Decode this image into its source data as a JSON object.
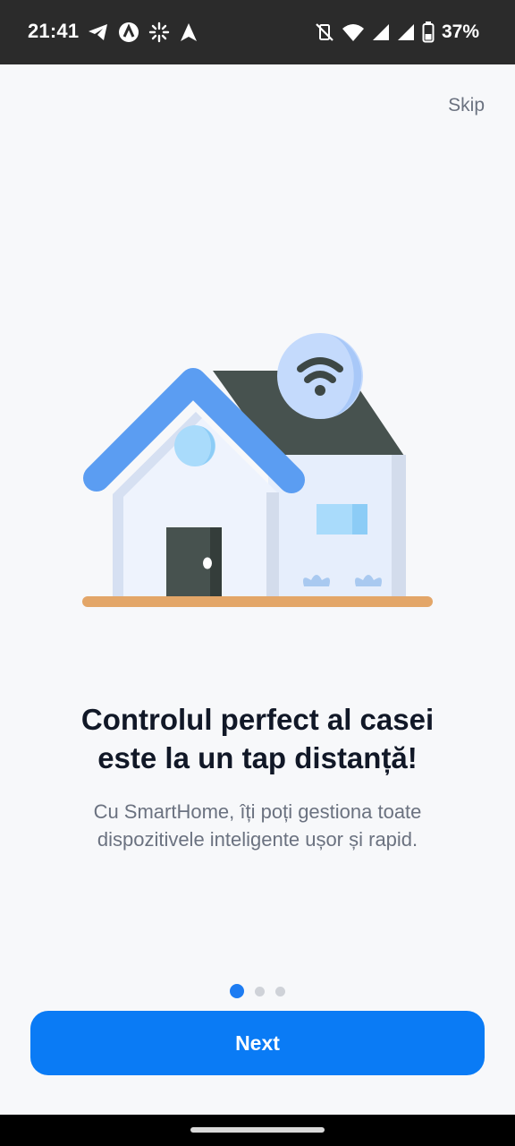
{
  "status_bar": {
    "time": "21:41",
    "left_icons": [
      "telegram-icon",
      "app-a-icon",
      "sparkle-icon",
      "navigation-arrow-icon"
    ],
    "right_icons": [
      "vibrate-off-icon",
      "wifi-icon",
      "signal-icon",
      "signal-icon",
      "battery-icon"
    ],
    "battery": "37%"
  },
  "onboarding": {
    "skip_label": "Skip",
    "illustration": "smart-home-wifi-illustration",
    "title_line1": "Controlul perfect al casei",
    "title_line2": "este la un tap distanță!",
    "subtitle_line1": "Cu SmartHome, îți poți gestiona toate",
    "subtitle_line2": "dispozitivele inteligente ușor și rapid.",
    "page_count": 3,
    "current_page": 1,
    "next_label": "Next"
  },
  "colors": {
    "accent": "#0a7bf5",
    "background": "#f7f8fa",
    "title": "#111827",
    "muted": "#6b7280"
  }
}
